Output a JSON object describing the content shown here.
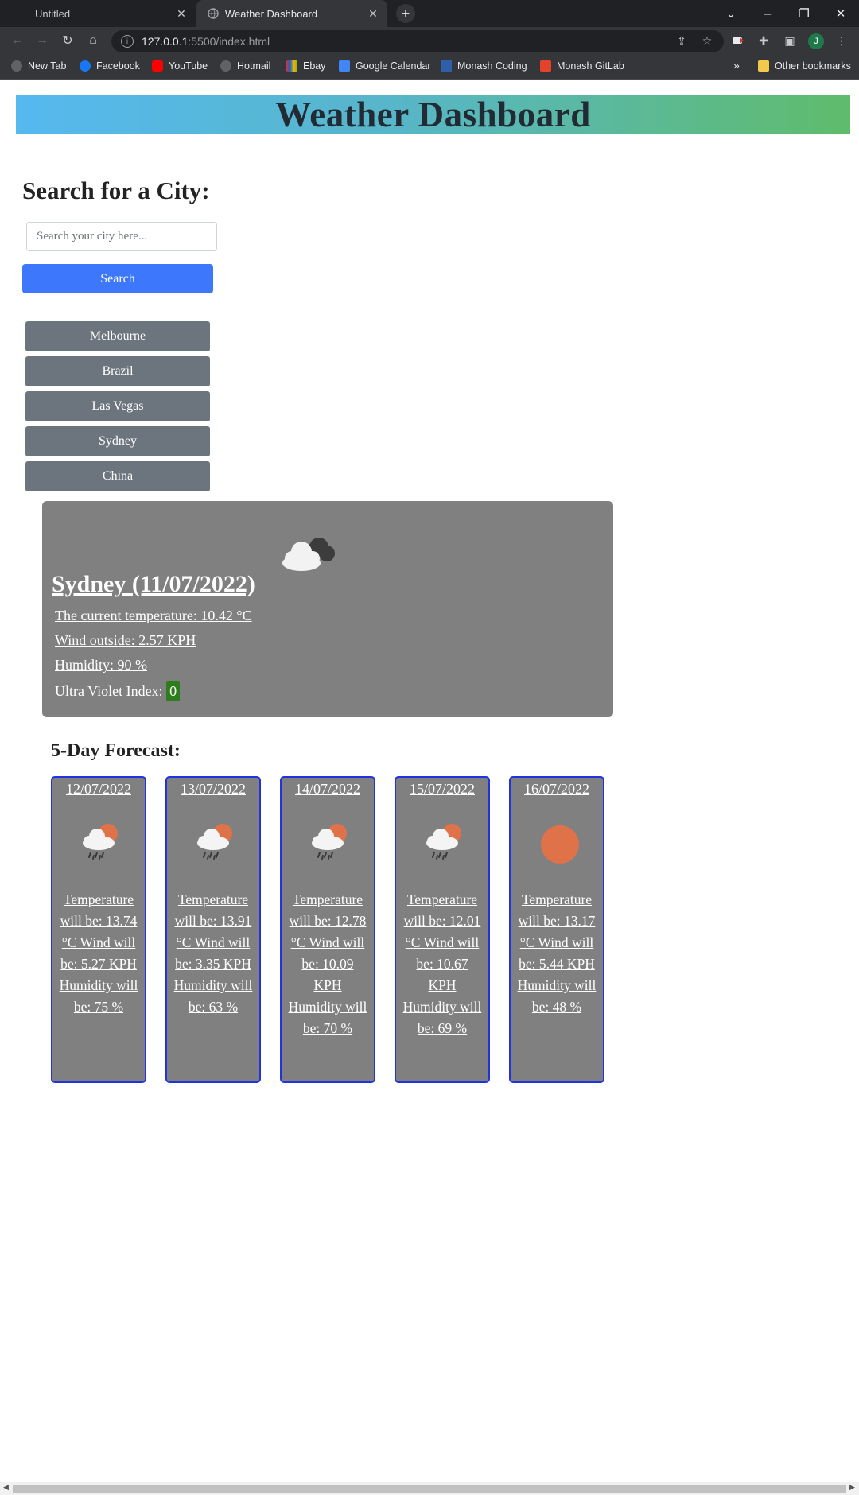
{
  "browser": {
    "tabs": [
      {
        "title": "Untitled",
        "active": false
      },
      {
        "title": "Weather Dashboard",
        "active": true
      }
    ],
    "url_host": "127.0.0.1",
    "url_rest": ":5500/index.html",
    "profile_initial": "J",
    "bookmarks": [
      {
        "label": "New Tab",
        "icon": "globe-icon"
      },
      {
        "label": "Facebook",
        "icon": "facebook-icon"
      },
      {
        "label": "YouTube",
        "icon": "youtube-icon"
      },
      {
        "label": "Hotmail",
        "icon": "globe-icon"
      },
      {
        "label": "Ebay",
        "icon": "ebay-icon"
      },
      {
        "label": "Google Calendar",
        "icon": "calendar-icon"
      },
      {
        "label": "Monash Coding",
        "icon": "monash-icon"
      },
      {
        "label": "Monash  GitLab",
        "icon": "gitlab-icon"
      }
    ],
    "bookmarks_overflow": "»",
    "other_bookmarks": "Other bookmarks"
  },
  "page": {
    "title": "Weather Dashboard",
    "search_heading": "Search for a City:",
    "search_placeholder": "Search your city here...",
    "search_button": "Search",
    "history": [
      "Melbourne",
      "Brazil",
      "Las Vegas",
      "Sydney",
      "China"
    ],
    "current": {
      "title": "Sydney (11/07/2022) ",
      "temp": "The current temperature: 10.42 °C",
      "wind": "Wind outside: 2.57 KPH",
      "humidity": "Humidity: 90 %",
      "uv_label": "Ultra Violet Index: ",
      "uv_value": "0",
      "uv_color": "#2e7d1c",
      "icon": "cloudy-icon"
    },
    "forecast_heading": "5-Day Forecast:",
    "forecast": [
      {
        "date": "12/07/2022",
        "text": "Temperature will be: 13.74 °C Wind will be: 5.27 KPH Humidity will be: 75 %",
        "icon": "rain-sun-icon"
      },
      {
        "date": "13/07/2022",
        "text": "Temperature will be: 13.91 °C Wind will be: 3.35 KPH Humidity will be: 63 %",
        "icon": "rain-sun-icon"
      },
      {
        "date": "14/07/2022",
        "text": "Temperature will be: 12.78 °C Wind will be: 10.09 KPH Humidity will be: 70 %",
        "icon": "rain-sun-icon"
      },
      {
        "date": "15/07/2022",
        "text": "Temperature will be: 12.01 °C Wind will be: 10.67 KPH Humidity will be: 69 %",
        "icon": "rain-sun-icon"
      },
      {
        "date": "16/07/2022",
        "text": "Temperature will be: 13.17 °C Wind will be: 5.44 KPH Humidity will be: 48 %",
        "icon": "sun-icon"
      }
    ]
  },
  "colors": {
    "accent_button": "#3d78fc",
    "history_button": "#6c757d",
    "card_bg": "#808080",
    "card_border": "#1f33e0",
    "sun": "#e0724a"
  }
}
